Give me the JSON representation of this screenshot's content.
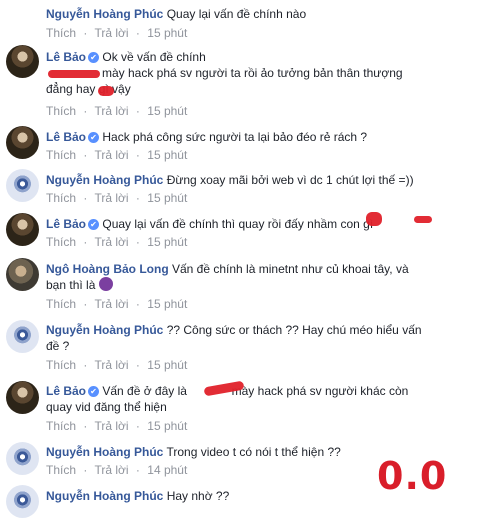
{
  "meta": {
    "like": "Thích",
    "dot": "·",
    "reply": "Trả lời"
  },
  "comments": [
    {
      "author": "Nguyễn Hoàng Phúc",
      "verified": false,
      "text": "Quay lại vấn đề chính nào",
      "time": "15 phút"
    },
    {
      "author": "Lê Bảo",
      "verified": true,
      "text": "Ok về vấn đề chính",
      "text2": "mày hack phá sv người ta rồi ảo tưởng bản thân thượng",
      "text3": "đẳng hay gì vậy",
      "time": "15 phút"
    },
    {
      "author": "Lê Bảo",
      "verified": true,
      "text": "Hack phá công sức người ta lại bảo đéo rẻ rách ?",
      "time": "15 phút"
    },
    {
      "author": "Nguyễn Hoàng Phúc",
      "verified": false,
      "text": "Đừng xoay mãi bởi web vì dc 1 chút lợi thế =))",
      "time": "15 phút"
    },
    {
      "author": "Lê Bảo",
      "verified": true,
      "text": "Quay lại vấn đề chính thì quay rồi đấy nhầm con gì",
      "time": "15 phút"
    },
    {
      "author": "Ngô Hoàng Bảo Long",
      "verified": false,
      "text": "Vấn đề chính là minetnt như củ khoai tây, và",
      "text2": "bạn thì là",
      "emoji": "eggplant",
      "time": "15 phút"
    },
    {
      "author": "Nguyễn Hoàng Phúc",
      "verified": false,
      "text": "?? Công sức or thách ?? Hay chú méo hiểu vấn",
      "text2": "đề ?",
      "time": "15 phút"
    },
    {
      "author": "Lê Bảo",
      "verified": true,
      "text": "Vấn đề ở đây là",
      "text_b": "mày hack phá sv người khác còn",
      "text2": "quay vid đăng thể hiện",
      "time": "15 phút"
    },
    {
      "author": "Nguyễn Hoàng Phúc",
      "verified": false,
      "text": "Trong video t có nói t thể hiện ??",
      "time": "14 phút"
    },
    {
      "author": "Nguyễn Hoàng Phúc",
      "verified": false,
      "text": "Hay nhờ ??"
    }
  ],
  "annotation": "0.0",
  "badge_glyph": "✔"
}
